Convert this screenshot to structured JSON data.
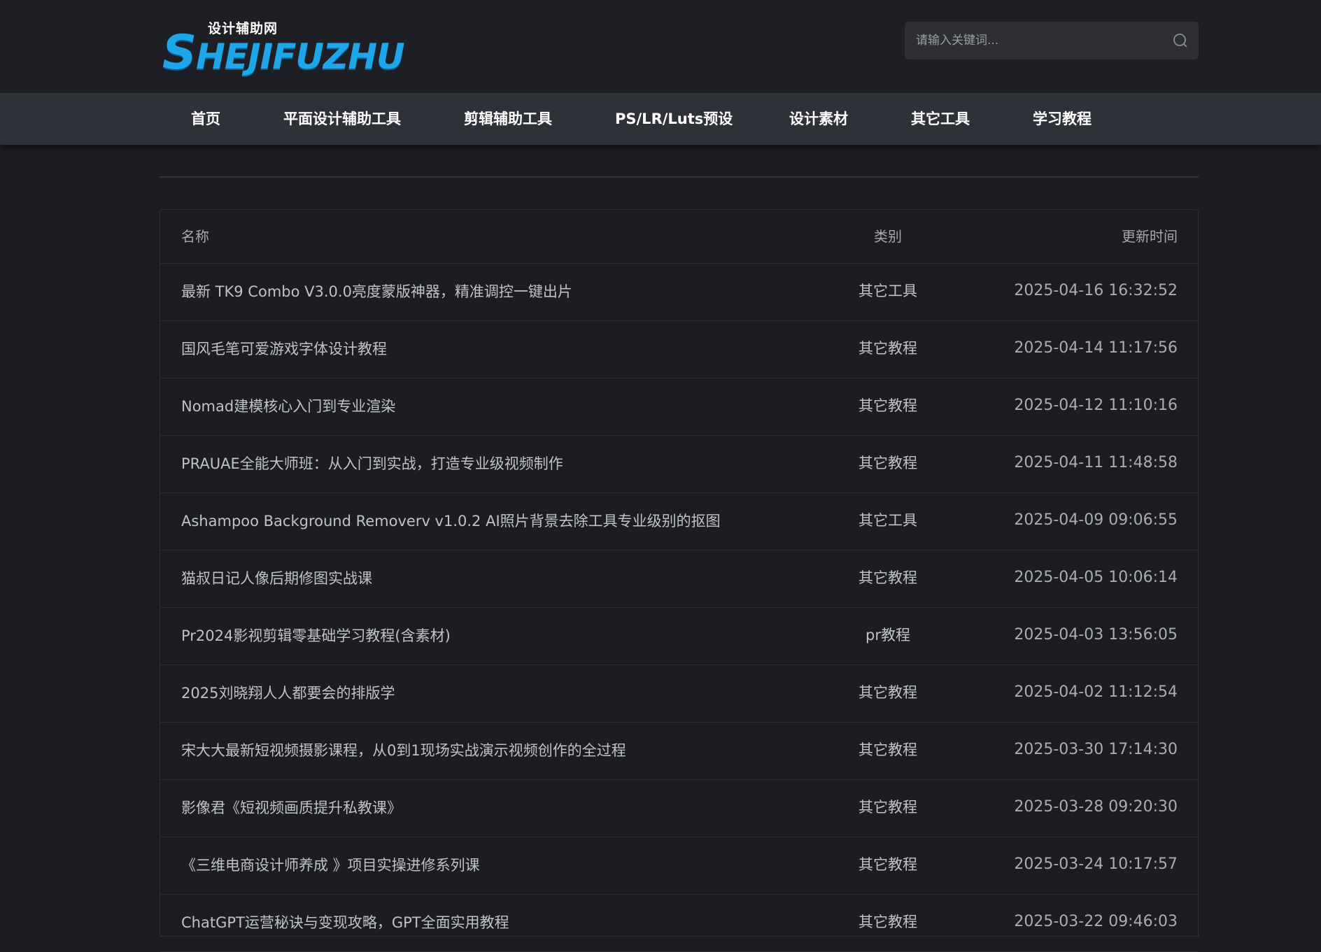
{
  "header": {
    "logo_sub": "设计辅助网",
    "logo_initial": "S",
    "logo_rest": "HEJIFUZHU",
    "search_placeholder": "请输入关键词..."
  },
  "nav": {
    "items": [
      {
        "label": "首页"
      },
      {
        "label": "平面设计辅助工具"
      },
      {
        "label": "剪辑辅助工具"
      },
      {
        "label": "PS/LR/Luts预设"
      },
      {
        "label": "设计素材"
      },
      {
        "label": "其它工具"
      },
      {
        "label": "学习教程"
      }
    ]
  },
  "table": {
    "headers": {
      "name": "名称",
      "category": "类别",
      "time": "更新时间"
    },
    "rows": [
      {
        "name": "最新 TK9 Combo V3.0.0亮度蒙版神器，精准调控一键出片",
        "category": "其它工具",
        "time": "2025-04-16 16:32:52"
      },
      {
        "name": "国风毛笔可爱游戏字体设计教程",
        "category": "其它教程",
        "time": "2025-04-14 11:17:56"
      },
      {
        "name": "Nomad建模核心入门到专业渲染",
        "category": "其它教程",
        "time": "2025-04-12 11:10:16"
      },
      {
        "name": "PRAUAE全能大师班：从入门到实战，打造专业级视频制作",
        "category": "其它教程",
        "time": "2025-04-11 11:48:58"
      },
      {
        "name": "Ashampoo Background Removerv v1.0.2 AI照片背景去除工具专业级别的抠图",
        "category": "其它工具",
        "time": "2025-04-09 09:06:55"
      },
      {
        "name": "猫叔日记人像后期修图实战课",
        "category": "其它教程",
        "time": "2025-04-05 10:06:14"
      },
      {
        "name": "Pr2024影视剪辑零基础学习教程(含素材)",
        "category": "pr教程",
        "time": "2025-04-03 13:56:05"
      },
      {
        "name": "2025刘晓翔人人都要会的排版学",
        "category": "其它教程",
        "time": "2025-04-02 11:12:54"
      },
      {
        "name": "宋大大最新短视频摄影课程，从0到1现场实战演示视频创作的全过程",
        "category": "其它教程",
        "time": "2025-03-30 17:14:30"
      },
      {
        "name": "影像君《短视频画质提升私教课》",
        "category": "其它教程",
        "time": "2025-03-28 09:20:30"
      },
      {
        "name": "《三维电商设计师养成 》项目实操进修系列课",
        "category": "其它教程",
        "time": "2025-03-24 10:17:57"
      },
      {
        "name": "ChatGPT运营秘诀与变现攻略，GPT全面实用教程",
        "category": "其它教程",
        "time": "2025-03-22 09:46:03"
      }
    ]
  }
}
